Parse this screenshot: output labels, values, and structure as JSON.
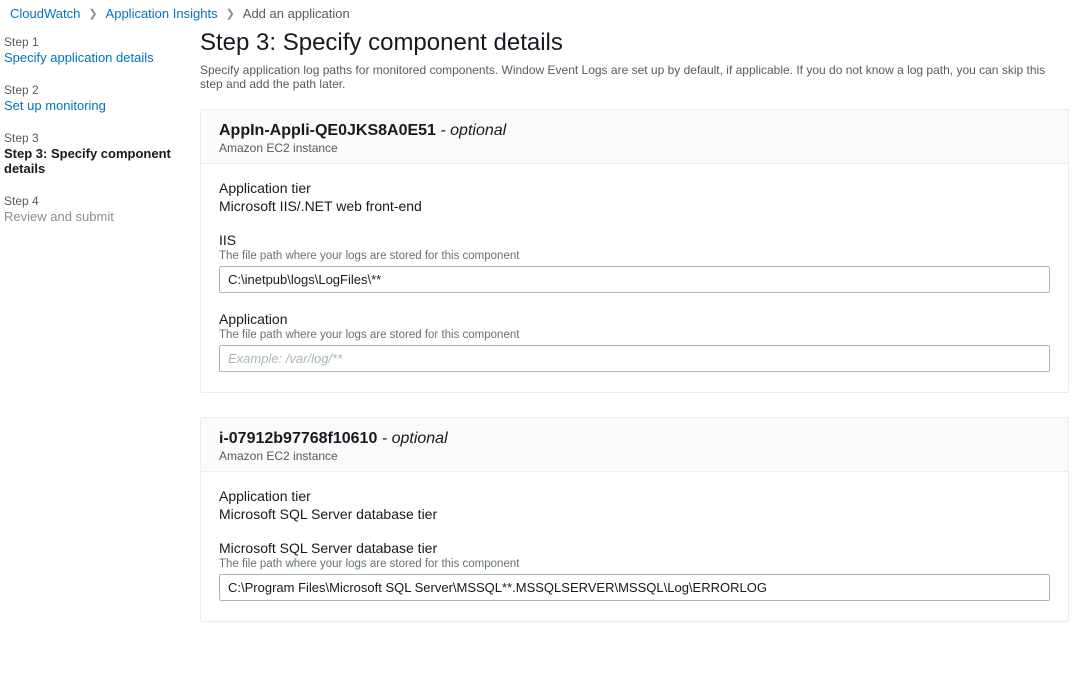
{
  "breadcrumb": {
    "items": [
      "CloudWatch",
      "Application Insights",
      "Add an application"
    ]
  },
  "sidebar": {
    "steps": [
      {
        "label": "Step 1",
        "title": "Specify application details",
        "state": "link"
      },
      {
        "label": "Step 2",
        "title": "Set up monitoring",
        "state": "link"
      },
      {
        "label": "Step 3",
        "title": "Step 3: Specify component details",
        "state": "current"
      },
      {
        "label": "Step 4",
        "title": "Review and submit",
        "state": "future"
      }
    ]
  },
  "main": {
    "title": "Step 3: Specify component details",
    "description": "Specify application log paths for monitored components. Window Event Logs are set up by default, if applicable. If you do not know a log path, you can skip this step and add the path later.",
    "optional_suffix": " - optional",
    "log_hint": "The file path where your logs are stored for this component",
    "tier_label": "Application tier",
    "components": [
      {
        "name": "AppIn-Appli-QE0JKS8A0E51",
        "subtype": "Amazon EC2 instance",
        "tier": "Microsoft IIS/.NET web front-end",
        "log_inputs": [
          {
            "label": "IIS",
            "value": "C:\\inetpub\\logs\\LogFiles\\**",
            "placeholder": ""
          },
          {
            "label": "Application",
            "value": "",
            "placeholder": "Example: /var/log/**"
          }
        ]
      },
      {
        "name": "i-07912b97768f10610",
        "subtype": "Amazon EC2 instance",
        "tier": "Microsoft SQL Server database tier",
        "log_inputs": [
          {
            "label": "Microsoft SQL Server database tier",
            "value": "C:\\Program Files\\Microsoft SQL Server\\MSSQL**.MSSQLSERVER\\MSSQL\\Log\\ERRORLOG",
            "placeholder": ""
          }
        ]
      }
    ]
  }
}
